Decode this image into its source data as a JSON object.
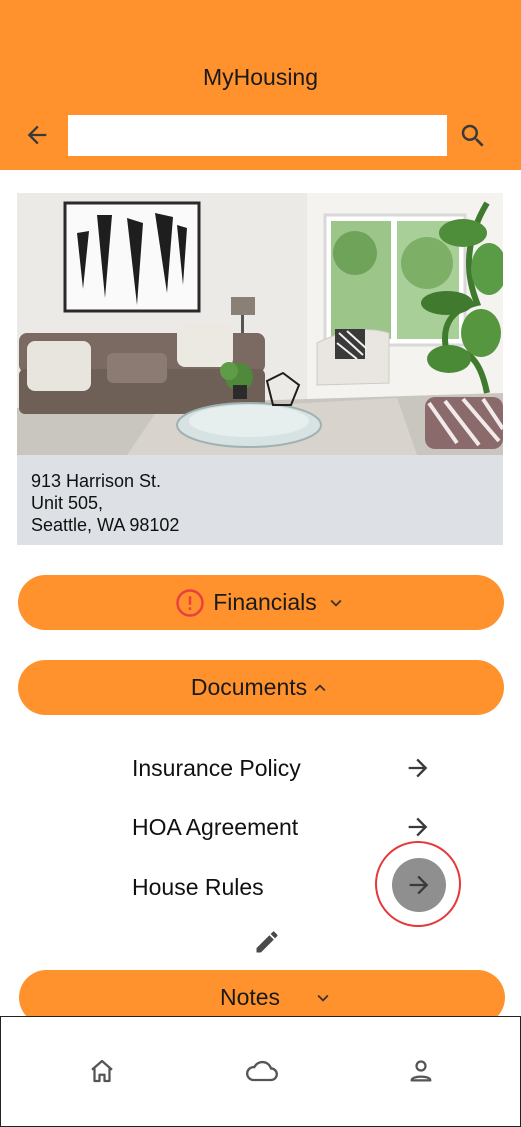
{
  "app": {
    "title": "MyHousing",
    "accent_color": "#ff922c"
  },
  "search": {
    "value": "",
    "placeholder": ""
  },
  "property": {
    "address_line1": "913 Harrison St.",
    "address_line2": "Unit 505,",
    "address_line3": "Seattle, WA 98102"
  },
  "sections": {
    "financials": {
      "label": "Financials",
      "alert_icon": "alert-circle-icon",
      "state": "collapsed"
    },
    "documents": {
      "label": "Documents",
      "state": "expanded"
    },
    "notes": {
      "label": "Notes",
      "state": "collapsed"
    }
  },
  "documents": {
    "items": [
      {
        "label": "Insurance Policy"
      },
      {
        "label": "HOA Agreement"
      },
      {
        "label": "House Rules"
      }
    ]
  },
  "bottom_nav": {
    "items": [
      {
        "icon": "home-icon"
      },
      {
        "icon": "cloud-icon"
      },
      {
        "icon": "profile-icon"
      }
    ]
  }
}
